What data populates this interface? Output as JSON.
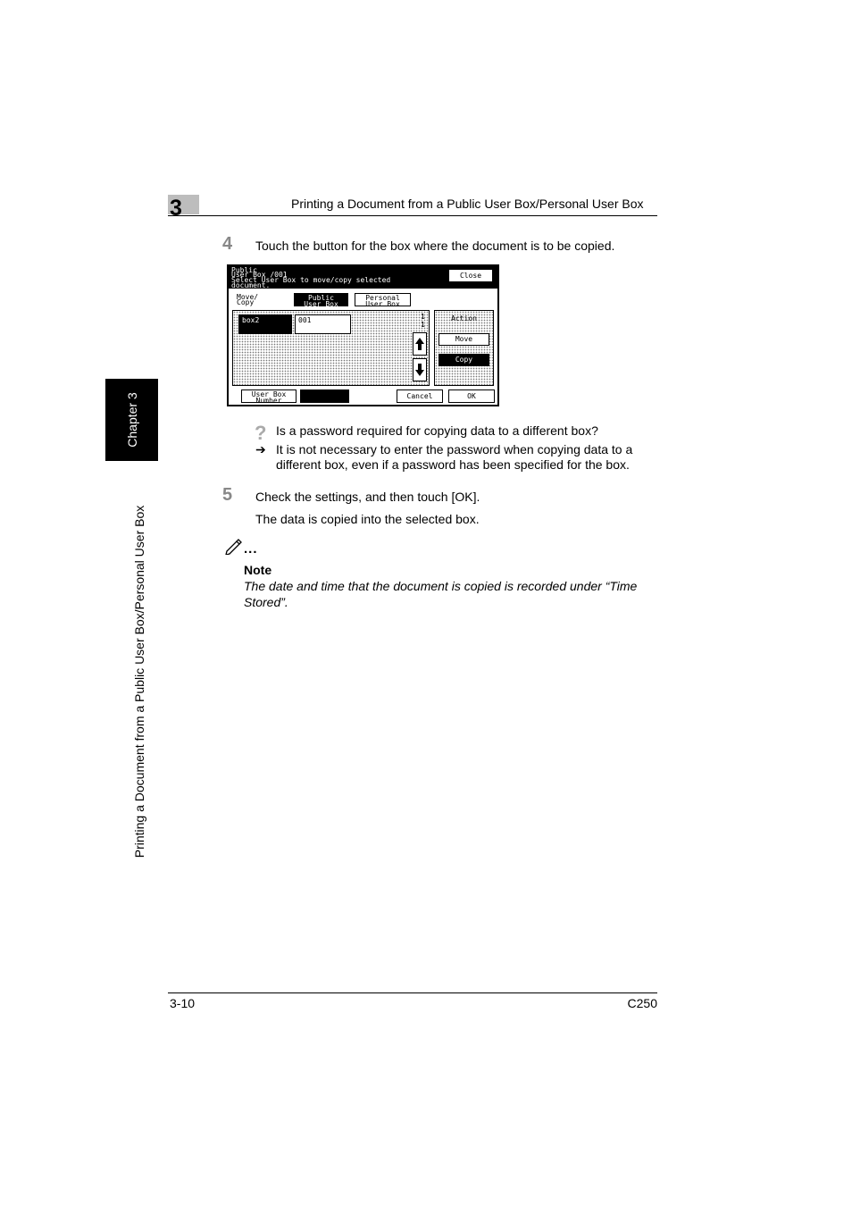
{
  "header": {
    "chapter_number": "3",
    "title": "Printing a Document from a Public User Box/Personal User Box"
  },
  "side_tab": {
    "chapter_label": "Chapter 3",
    "running_title": "Printing a Document from a Public User Box/Personal User Box"
  },
  "step4": {
    "number": "4",
    "text": "Touch the button for the box where the document is to be copied."
  },
  "screen": {
    "title_lines": [
      "Public",
      "User Box   /001",
      "Select User Box to move/copy selected",
      "document."
    ],
    "close_label": "Close",
    "move_copy_label_lines": [
      "Move/",
      "Copy"
    ],
    "public_tab_lines": [
      "Public",
      "User Box"
    ],
    "personal_tab_lines": [
      "Personal",
      "User Box"
    ],
    "box_selected": "box2",
    "box_id": "001",
    "page_current": "1",
    "page_total": "1",
    "action_label": "Action",
    "move_label": "Move",
    "copy_label": "Copy",
    "user_box_number_lines": [
      "User Box",
      "Number"
    ],
    "cancel_label": "Cancel",
    "ok_label": "OK",
    "up_icon": "arrow-up-icon",
    "down_icon": "arrow-down-icon"
  },
  "qa": {
    "question_icon": "?",
    "question": "Is a password required for copying data to a different box?",
    "answer_arrow": "➔",
    "answer_lines": [
      "It is not necessary to enter the password when copying data to a",
      "different box, even if a password has been specified for the box."
    ]
  },
  "step5": {
    "number": "5",
    "text": "Check the settings, and then touch [OK].",
    "result": "The data is copied into the selected box."
  },
  "note": {
    "icon": "pencil-icon",
    "dots": "...",
    "heading": "Note",
    "lines": [
      "The date and time that the document is copied is recorded under “Time",
      "Stored”."
    ]
  },
  "footer": {
    "page": "3-10",
    "model": "C250"
  }
}
